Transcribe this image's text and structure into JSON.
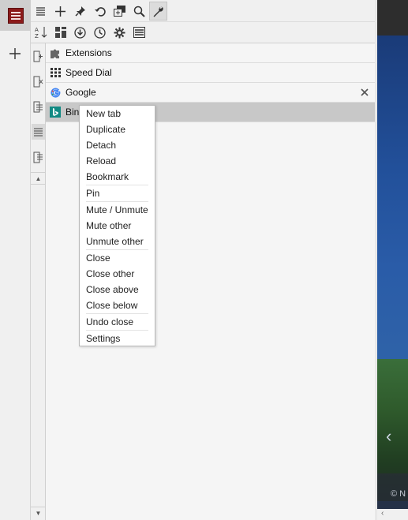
{
  "icons": {
    "main_menu": "hamburger-menu-icon",
    "new_panel": "plus-icon",
    "toolbar_top": [
      "list-icon",
      "plus-icon",
      "pin-icon",
      "undo-icon",
      "restore-window-icon",
      "search-icon",
      "wrench-icon"
    ],
    "toolbar_bottom": [
      "sort-az-icon",
      "grid-icon",
      "download-icon",
      "clock-icon",
      "gear-icon",
      "menu-list-icon"
    ]
  },
  "tabs": [
    {
      "label": "Extensions",
      "icon": "puzzle-icon"
    },
    {
      "label": "Speed Dial",
      "icon": "speed-dial-grid-icon"
    },
    {
      "label": "Google",
      "icon": "google-g-icon",
      "closable": true
    },
    {
      "label": "Bing",
      "icon": "bing-icon",
      "selected": true
    }
  ],
  "context_menu": {
    "items": [
      "New tab",
      "Duplicate",
      "Detach",
      "Reload",
      "Bookmark",
      "Pin",
      "Mute / Unmute",
      "Mute other",
      "Unmute other",
      "Close",
      "Close other",
      "Close above",
      "Close below",
      "Undo close",
      "Settings"
    ]
  },
  "background": {
    "chevron": "‹",
    "copyright": "© N",
    "bottom": "‹"
  },
  "colors": {
    "menu_button": "#8b1a1a",
    "selected_row": "#c8c8c8",
    "bing_teal": "#138a83"
  }
}
